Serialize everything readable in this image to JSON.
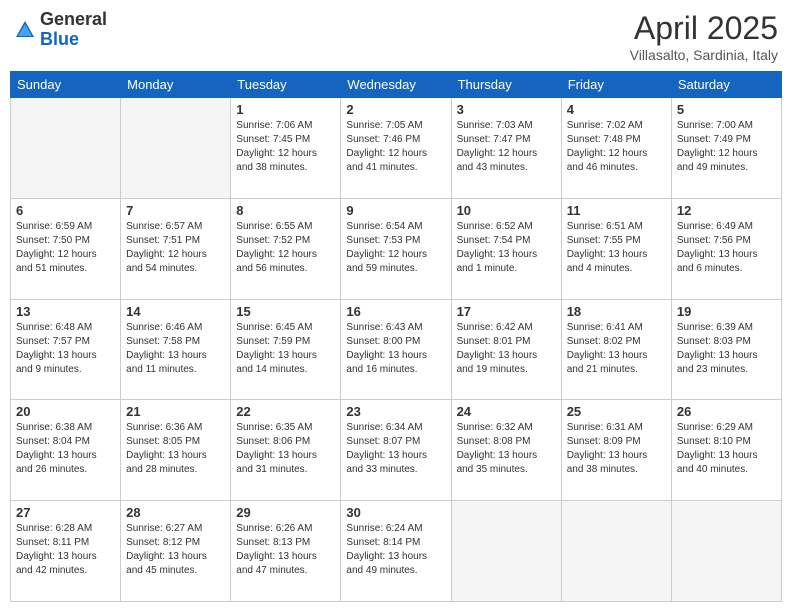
{
  "header": {
    "logo_general": "General",
    "logo_blue": "Blue",
    "title": "April 2025",
    "subtitle": "Villasalto, Sardinia, Italy"
  },
  "weekdays": [
    "Sunday",
    "Monday",
    "Tuesday",
    "Wednesday",
    "Thursday",
    "Friday",
    "Saturday"
  ],
  "weeks": [
    [
      null,
      null,
      {
        "day": "1",
        "sunrise": "Sunrise: 7:06 AM",
        "sunset": "Sunset: 7:45 PM",
        "daylight": "Daylight: 12 hours and 38 minutes."
      },
      {
        "day": "2",
        "sunrise": "Sunrise: 7:05 AM",
        "sunset": "Sunset: 7:46 PM",
        "daylight": "Daylight: 12 hours and 41 minutes."
      },
      {
        "day": "3",
        "sunrise": "Sunrise: 7:03 AM",
        "sunset": "Sunset: 7:47 PM",
        "daylight": "Daylight: 12 hours and 43 minutes."
      },
      {
        "day": "4",
        "sunrise": "Sunrise: 7:02 AM",
        "sunset": "Sunset: 7:48 PM",
        "daylight": "Daylight: 12 hours and 46 minutes."
      },
      {
        "day": "5",
        "sunrise": "Sunrise: 7:00 AM",
        "sunset": "Sunset: 7:49 PM",
        "daylight": "Daylight: 12 hours and 49 minutes."
      }
    ],
    [
      {
        "day": "6",
        "sunrise": "Sunrise: 6:59 AM",
        "sunset": "Sunset: 7:50 PM",
        "daylight": "Daylight: 12 hours and 51 minutes."
      },
      {
        "day": "7",
        "sunrise": "Sunrise: 6:57 AM",
        "sunset": "Sunset: 7:51 PM",
        "daylight": "Daylight: 12 hours and 54 minutes."
      },
      {
        "day": "8",
        "sunrise": "Sunrise: 6:55 AM",
        "sunset": "Sunset: 7:52 PM",
        "daylight": "Daylight: 12 hours and 56 minutes."
      },
      {
        "day": "9",
        "sunrise": "Sunrise: 6:54 AM",
        "sunset": "Sunset: 7:53 PM",
        "daylight": "Daylight: 12 hours and 59 minutes."
      },
      {
        "day": "10",
        "sunrise": "Sunrise: 6:52 AM",
        "sunset": "Sunset: 7:54 PM",
        "daylight": "Daylight: 13 hours and 1 minute."
      },
      {
        "day": "11",
        "sunrise": "Sunrise: 6:51 AM",
        "sunset": "Sunset: 7:55 PM",
        "daylight": "Daylight: 13 hours and 4 minutes."
      },
      {
        "day": "12",
        "sunrise": "Sunrise: 6:49 AM",
        "sunset": "Sunset: 7:56 PM",
        "daylight": "Daylight: 13 hours and 6 minutes."
      }
    ],
    [
      {
        "day": "13",
        "sunrise": "Sunrise: 6:48 AM",
        "sunset": "Sunset: 7:57 PM",
        "daylight": "Daylight: 13 hours and 9 minutes."
      },
      {
        "day": "14",
        "sunrise": "Sunrise: 6:46 AM",
        "sunset": "Sunset: 7:58 PM",
        "daylight": "Daylight: 13 hours and 11 minutes."
      },
      {
        "day": "15",
        "sunrise": "Sunrise: 6:45 AM",
        "sunset": "Sunset: 7:59 PM",
        "daylight": "Daylight: 13 hours and 14 minutes."
      },
      {
        "day": "16",
        "sunrise": "Sunrise: 6:43 AM",
        "sunset": "Sunset: 8:00 PM",
        "daylight": "Daylight: 13 hours and 16 minutes."
      },
      {
        "day": "17",
        "sunrise": "Sunrise: 6:42 AM",
        "sunset": "Sunset: 8:01 PM",
        "daylight": "Daylight: 13 hours and 19 minutes."
      },
      {
        "day": "18",
        "sunrise": "Sunrise: 6:41 AM",
        "sunset": "Sunset: 8:02 PM",
        "daylight": "Daylight: 13 hours and 21 minutes."
      },
      {
        "day": "19",
        "sunrise": "Sunrise: 6:39 AM",
        "sunset": "Sunset: 8:03 PM",
        "daylight": "Daylight: 13 hours and 23 minutes."
      }
    ],
    [
      {
        "day": "20",
        "sunrise": "Sunrise: 6:38 AM",
        "sunset": "Sunset: 8:04 PM",
        "daylight": "Daylight: 13 hours and 26 minutes."
      },
      {
        "day": "21",
        "sunrise": "Sunrise: 6:36 AM",
        "sunset": "Sunset: 8:05 PM",
        "daylight": "Daylight: 13 hours and 28 minutes."
      },
      {
        "day": "22",
        "sunrise": "Sunrise: 6:35 AM",
        "sunset": "Sunset: 8:06 PM",
        "daylight": "Daylight: 13 hours and 31 minutes."
      },
      {
        "day": "23",
        "sunrise": "Sunrise: 6:34 AM",
        "sunset": "Sunset: 8:07 PM",
        "daylight": "Daylight: 13 hours and 33 minutes."
      },
      {
        "day": "24",
        "sunrise": "Sunrise: 6:32 AM",
        "sunset": "Sunset: 8:08 PM",
        "daylight": "Daylight: 13 hours and 35 minutes."
      },
      {
        "day": "25",
        "sunrise": "Sunrise: 6:31 AM",
        "sunset": "Sunset: 8:09 PM",
        "daylight": "Daylight: 13 hours and 38 minutes."
      },
      {
        "day": "26",
        "sunrise": "Sunrise: 6:29 AM",
        "sunset": "Sunset: 8:10 PM",
        "daylight": "Daylight: 13 hours and 40 minutes."
      }
    ],
    [
      {
        "day": "27",
        "sunrise": "Sunrise: 6:28 AM",
        "sunset": "Sunset: 8:11 PM",
        "daylight": "Daylight: 13 hours and 42 minutes."
      },
      {
        "day": "28",
        "sunrise": "Sunrise: 6:27 AM",
        "sunset": "Sunset: 8:12 PM",
        "daylight": "Daylight: 13 hours and 45 minutes."
      },
      {
        "day": "29",
        "sunrise": "Sunrise: 6:26 AM",
        "sunset": "Sunset: 8:13 PM",
        "daylight": "Daylight: 13 hours and 47 minutes."
      },
      {
        "day": "30",
        "sunrise": "Sunrise: 6:24 AM",
        "sunset": "Sunset: 8:14 PM",
        "daylight": "Daylight: 13 hours and 49 minutes."
      },
      null,
      null,
      null
    ]
  ]
}
